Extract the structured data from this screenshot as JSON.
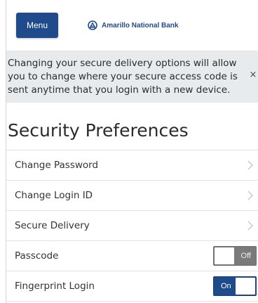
{
  "header": {
    "menu_label": "Menu",
    "bank_name": "Amarillo National Bank",
    "brand_color": "#1f4a8c"
  },
  "notice": {
    "text": "Changing your secure delivery options will allow you to change where your secure access code is sent anytime that you login with a new device.",
    "close_glyph": "×",
    "background": "#e8ebee"
  },
  "page": {
    "title": "Security Preferences"
  },
  "settings": {
    "items": [
      {
        "label": "Change Password",
        "control": "chevron",
        "icon": "chevron-right-icon"
      },
      {
        "label": "Change Login ID",
        "control": "chevron",
        "icon": "chevron-right-icon"
      },
      {
        "label": "Secure Delivery",
        "control": "chevron",
        "icon": "chevron-right-icon"
      },
      {
        "label": "Passcode",
        "control": "toggle",
        "state_label": "Off",
        "color": "#7a7a7a"
      },
      {
        "label": "Fingerprint Login",
        "control": "toggle",
        "state_label": "On",
        "color": "#1f4a8c"
      }
    ]
  }
}
